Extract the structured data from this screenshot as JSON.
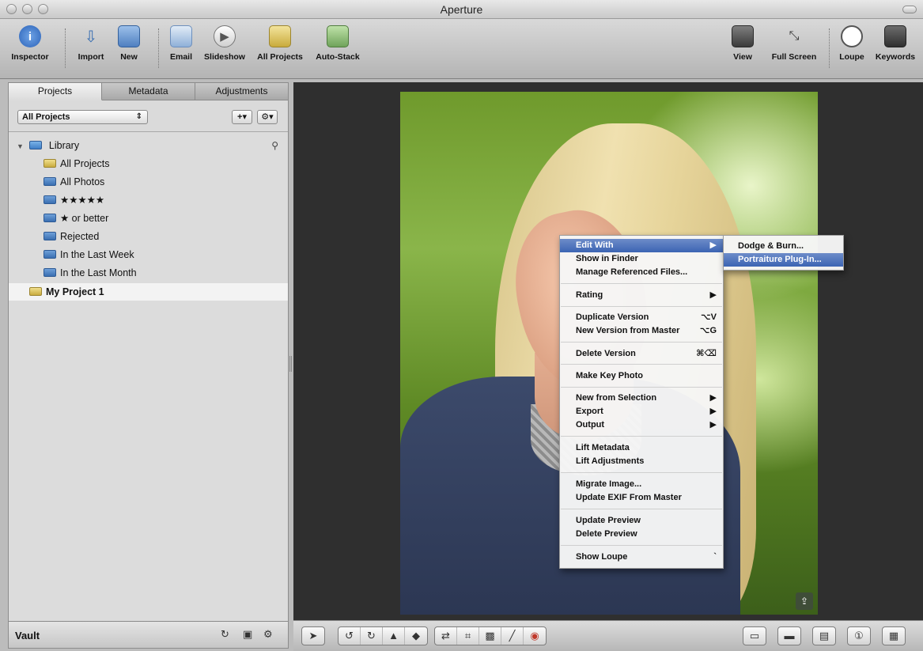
{
  "window": {
    "title": "Aperture"
  },
  "toolbar": {
    "inspector": "Inspector",
    "import": "Import",
    "new": "New",
    "email": "Email",
    "slideshow": "Slideshow",
    "all_projects": "All Projects",
    "auto_stack": "Auto-Stack",
    "view": "View",
    "full_screen": "Full Screen",
    "loupe": "Loupe",
    "keywords": "Keywords"
  },
  "panel": {
    "tabs": [
      "Projects",
      "Metadata",
      "Adjustments"
    ],
    "popup_value": "All Projects",
    "library": "Library",
    "items": [
      "All Projects",
      "All Photos",
      "★★★★★",
      "★ or better",
      "Rejected",
      "In the Last Week",
      "In the Last Month"
    ],
    "project": "My Project 1",
    "vault": "Vault"
  },
  "context_menu": {
    "items": [
      {
        "label": "Edit With",
        "shortcut": "▶"
      },
      {
        "label": "Show in Finder",
        "shortcut": ""
      },
      {
        "label": "Manage Referenced Files...",
        "shortcut": ""
      },
      {
        "label": "Rating",
        "shortcut": "▶"
      },
      {
        "label": "Duplicate Version",
        "shortcut": "⌥V"
      },
      {
        "label": "New Version from Master",
        "shortcut": "⌥G"
      },
      {
        "label": "Delete Version",
        "shortcut": "⌘⌫"
      },
      {
        "label": "Make Key Photo",
        "shortcut": ""
      },
      {
        "label": "New from Selection",
        "shortcut": "▶"
      },
      {
        "label": "Export",
        "shortcut": "▶"
      },
      {
        "label": "Output",
        "shortcut": "▶"
      },
      {
        "label": "Lift Metadata",
        "shortcut": ""
      },
      {
        "label": "Lift Adjustments",
        "shortcut": ""
      },
      {
        "label": "Migrate Image...",
        "shortcut": ""
      },
      {
        "label": "Update EXIF From Master",
        "shortcut": ""
      },
      {
        "label": "Update Preview",
        "shortcut": ""
      },
      {
        "label": "Delete Preview",
        "shortcut": ""
      },
      {
        "label": "Show Loupe",
        "shortcut": "`"
      }
    ]
  },
  "submenu": {
    "items": [
      "Dodge & Burn...",
      "Portraiture Plug-In..."
    ]
  },
  "colors": {
    "menu_highlight": "#3c64b3",
    "viewer_bg": "#2f2f2f",
    "panel_bg": "#dcdcdc"
  }
}
